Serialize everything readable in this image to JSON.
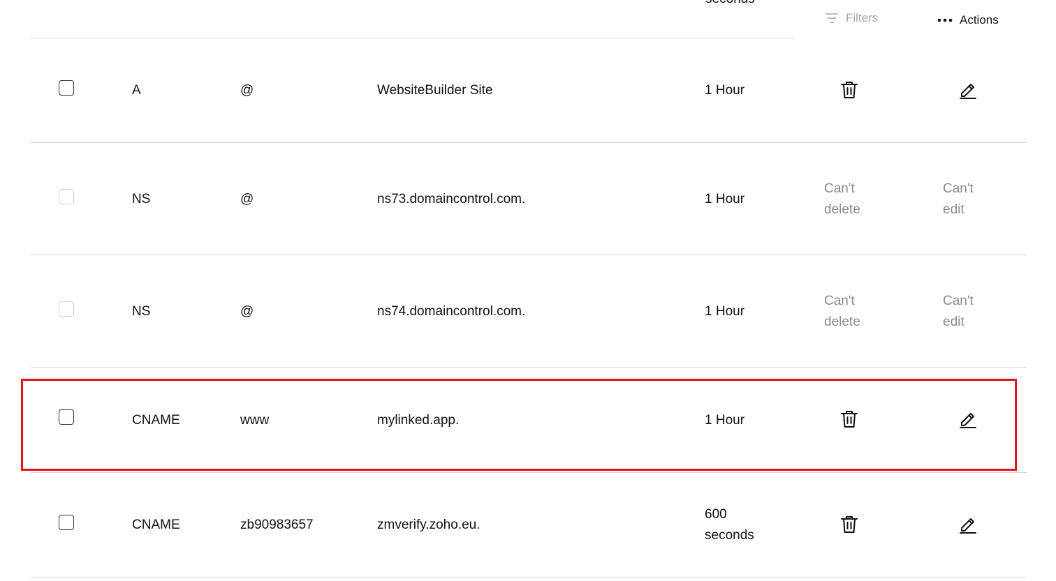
{
  "toolbar": {
    "clipped_ttl_text": "seconds",
    "filters_label": "Filters",
    "actions_label": "Actions",
    "filter_icon": "filter-lines-icon",
    "actions_icon": "more-horizontal-icon"
  },
  "records": [
    {
      "type": "A",
      "name": "@",
      "data": "WebsiteBuilder Site",
      "ttl": "1 Hour",
      "can_delete": true,
      "can_edit": true,
      "delete_text": "",
      "edit_text": "",
      "selectable": true
    },
    {
      "type": "NS",
      "name": "@",
      "data": "ns73.domaincontrol.com.",
      "ttl": "1 Hour",
      "can_delete": false,
      "can_edit": false,
      "delete_text": "Can't delete",
      "edit_text": "Can't edit",
      "selectable": false
    },
    {
      "type": "NS",
      "name": "@",
      "data": "ns74.domaincontrol.com.",
      "ttl": "1 Hour",
      "can_delete": false,
      "can_edit": false,
      "delete_text": "Can't delete",
      "edit_text": "Can't edit",
      "selectable": false
    },
    {
      "type": "CNAME",
      "name": "www",
      "data": "mylinked.app.",
      "ttl": "1 Hour",
      "can_delete": true,
      "can_edit": true,
      "delete_text": "",
      "edit_text": "",
      "selectable": true
    },
    {
      "type": "CNAME",
      "name": "zb90983657",
      "data": "zmverify.zoho.eu.",
      "ttl": "600 seconds",
      "can_delete": true,
      "can_edit": true,
      "delete_text": "",
      "edit_text": "",
      "selectable": true
    }
  ],
  "colors": {
    "highlight": "#e0141e",
    "divider": "#d4d4d4",
    "muted_text": "#8a8a8a"
  }
}
